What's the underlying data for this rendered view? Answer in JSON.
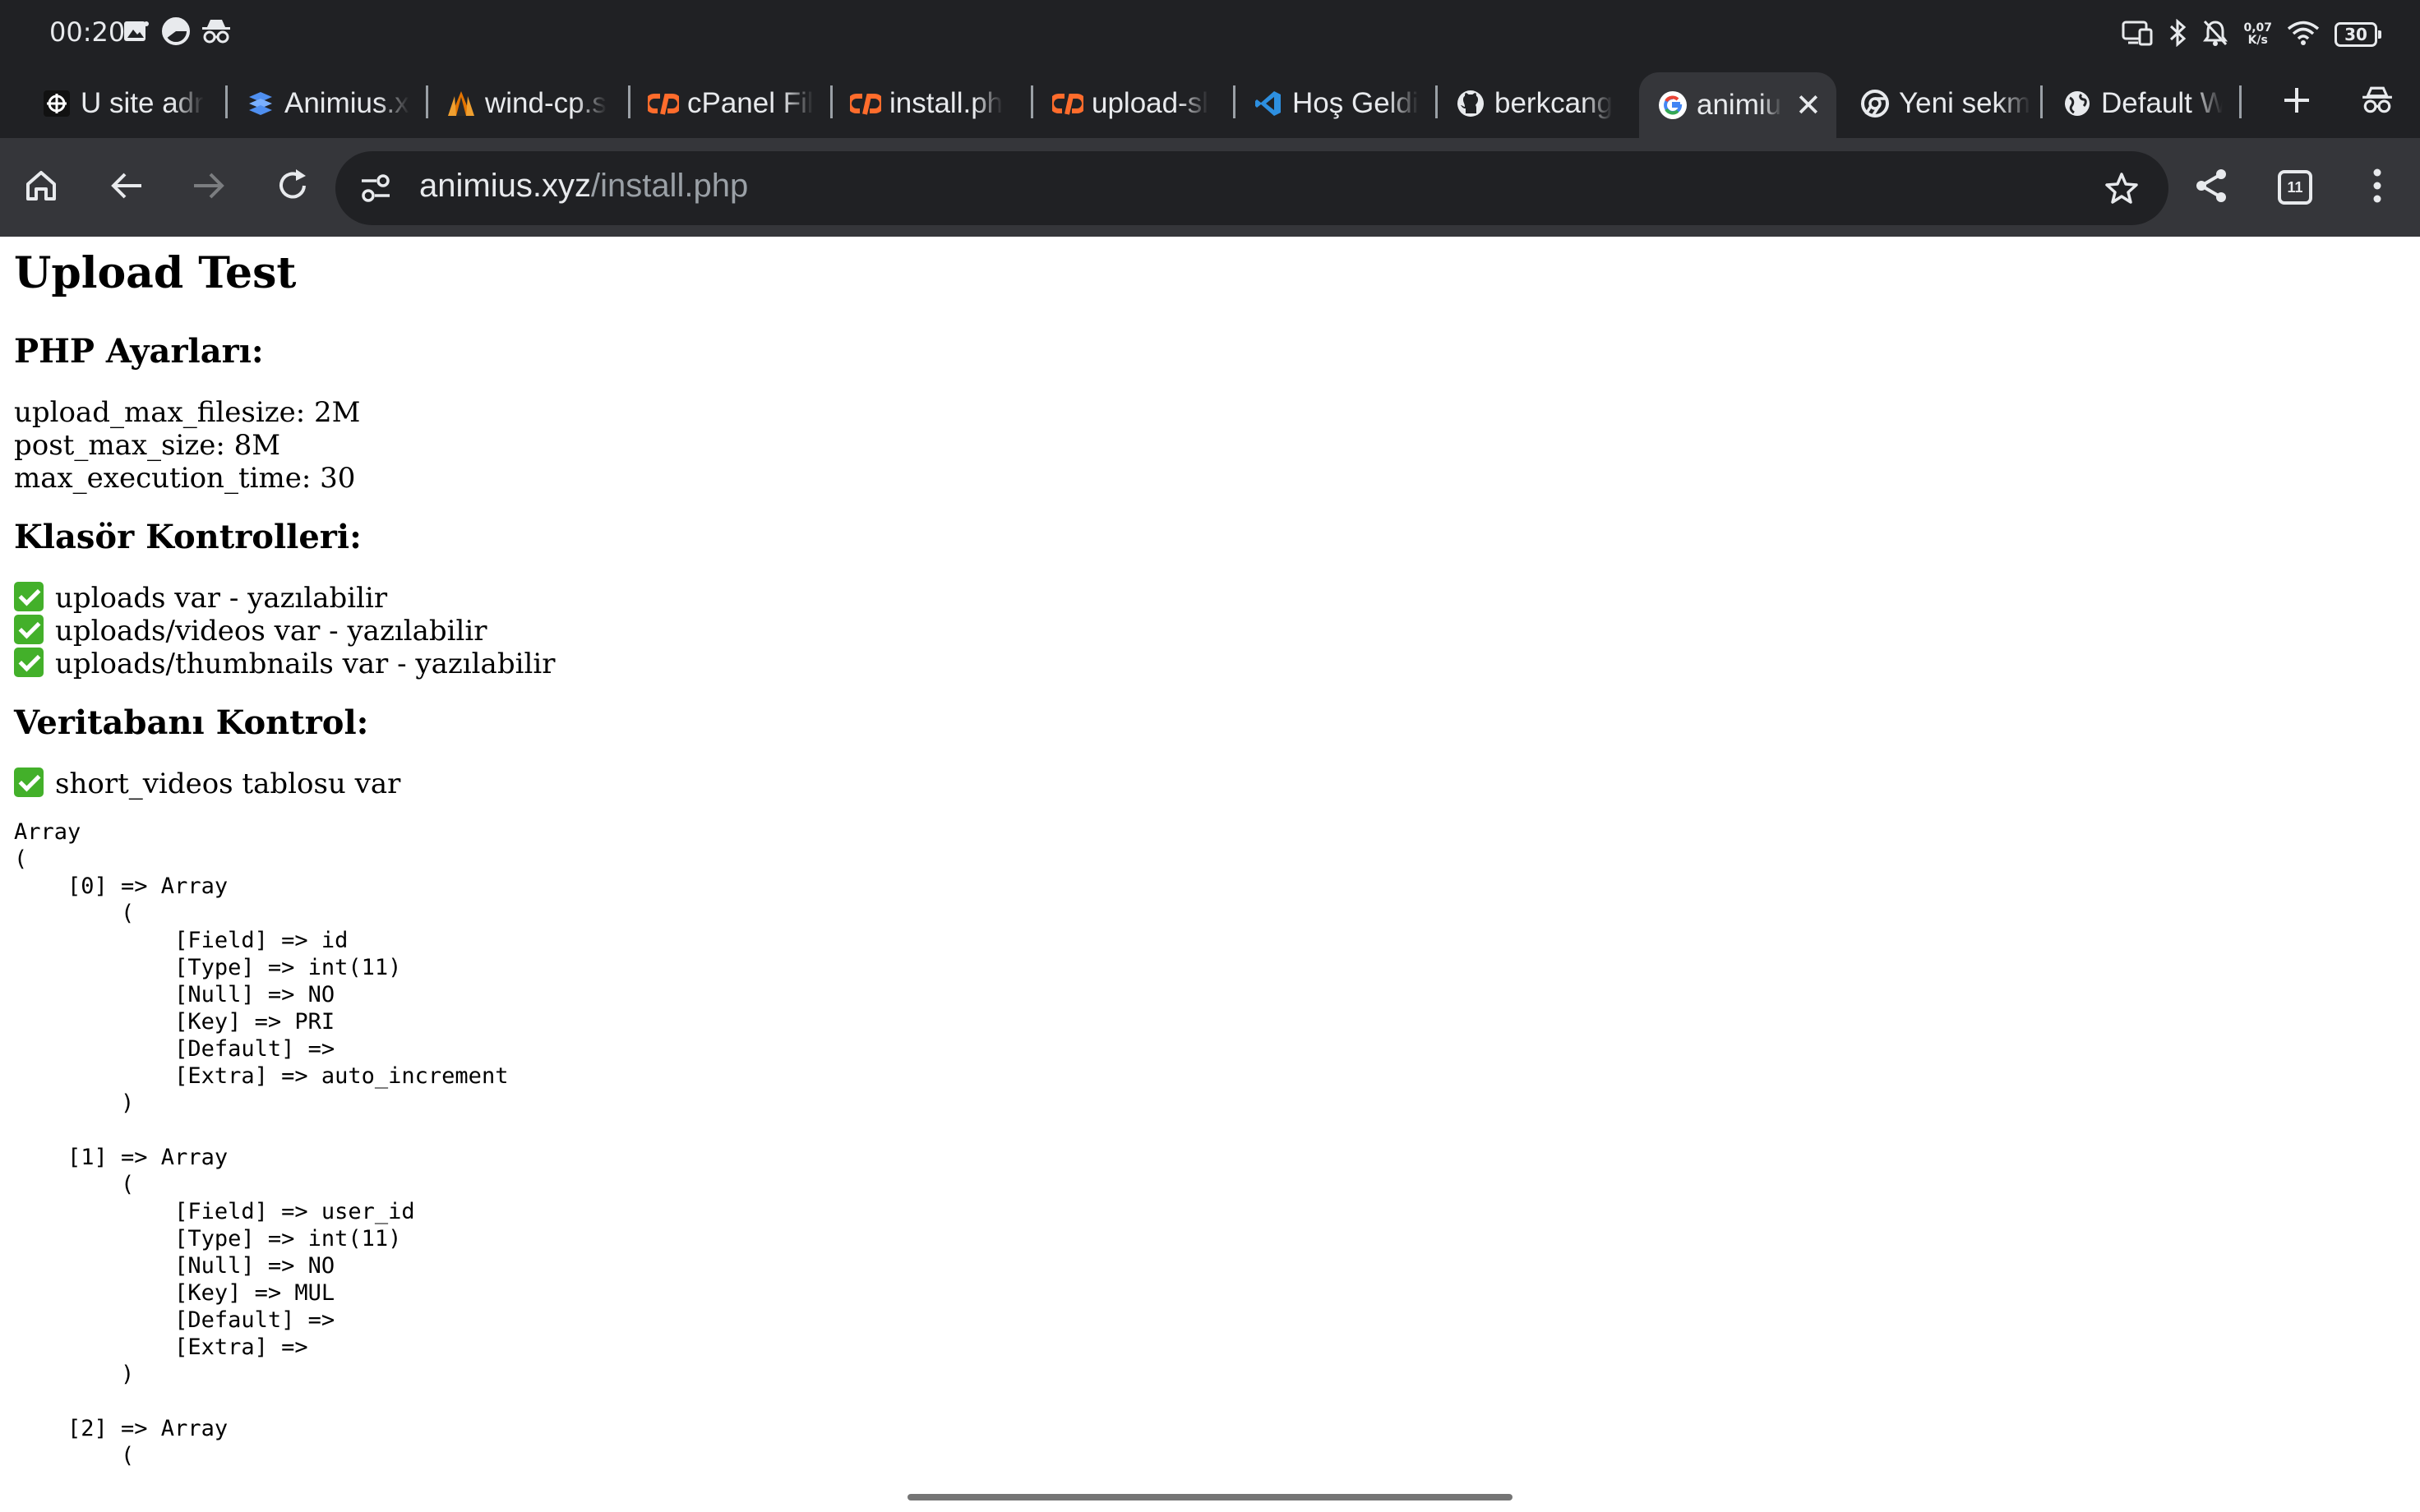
{
  "status_bar": {
    "time": "00:20",
    "speed_value": "0,07",
    "speed_unit": "K/s",
    "battery": "30"
  },
  "tabs": [
    {
      "label": "U site adr",
      "icon": "site-favicon-dark"
    },
    {
      "label": "Animius.x",
      "icon": "stack-favicon"
    },
    {
      "label": "wind-cp.s",
      "icon": "wind-favicon"
    },
    {
      "label": "cPanel Fil",
      "icon": "cpanel-favicon"
    },
    {
      "label": "install.ph",
      "icon": "cpanel-favicon"
    },
    {
      "label": "upload-sl",
      "icon": "cpanel-favicon"
    },
    {
      "label": "Hoş Geldi",
      "icon": "vscode-favicon"
    },
    {
      "label": "berkcang",
      "icon": "github-favicon"
    },
    {
      "label": "animius",
      "icon": "google-favicon",
      "active": true
    },
    {
      "label": "Yeni sekm",
      "icon": "chrome-favicon"
    },
    {
      "label": "Default W",
      "icon": "globe-favicon"
    }
  ],
  "toolbar": {
    "url_host": "animius.xyz",
    "url_path": "/install.php",
    "tab_count": "11"
  },
  "page": {
    "title": "Upload Test",
    "php_heading": "PHP Ayarları:",
    "php_settings": [
      "upload_max_filesize: 2M",
      "post_max_size: 8M",
      "max_execution_time: 30"
    ],
    "folder_heading": "Klasör Kontrolleri:",
    "folder_checks": [
      "uploads var - yazılabilir",
      "uploads/videos var - yazılabilir",
      "uploads/thumbnails var - yazılabilir"
    ],
    "db_heading": "Veritabanı Kontrol:",
    "db_check": "short_videos tablosu var",
    "array_dump": "Array\n(\n    [0] => Array\n        (\n            [Field] => id\n            [Type] => int(11)\n            [Null] => NO\n            [Key] => PRI\n            [Default] => \n            [Extra] => auto_increment\n        )\n\n    [1] => Array\n        (\n            [Field] => user_id\n            [Type] => int(11)\n            [Null] => NO\n            [Key] => MUL\n            [Default] => \n            [Extra] => \n        )\n\n    [2] => Array\n        ("
  },
  "colors": {
    "chrome_dark": "#202124",
    "toolbar": "#35363a",
    "check_green": "#43b02a"
  }
}
